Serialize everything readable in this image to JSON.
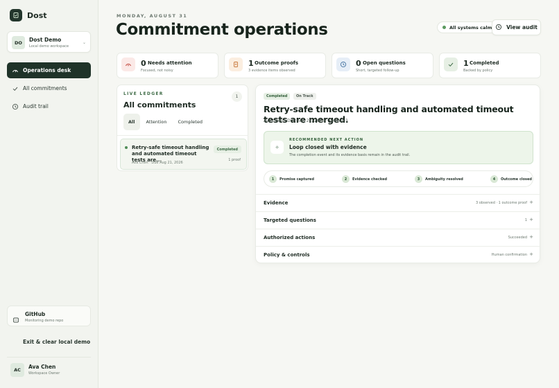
{
  "app": {
    "name": "Dost"
  },
  "workspace": {
    "initials": "DO",
    "name": "Dost Demo",
    "subtitle": "Local demo workspace"
  },
  "nav": [
    {
      "label": "Operations desk",
      "icon": "gauge-icon",
      "active": true
    },
    {
      "label": "All commitments",
      "icon": "check-icon",
      "active": false
    },
    {
      "label": "Audit trail",
      "icon": "history-icon",
      "active": false
    }
  ],
  "github": {
    "title": "GitHub",
    "subtitle": "Monitoring demo repo"
  },
  "exit_label": "Exit & clear local demo",
  "user": {
    "initials": "AC",
    "name": "Ava Chen",
    "role": "Workspace Owner"
  },
  "header": {
    "date": "MONDAY, AUGUST 31",
    "title": "Commitment operations",
    "status": "All systems calm",
    "view_audit": "View audit"
  },
  "stats": [
    {
      "num": "0",
      "label": "Needs attention",
      "sub": "Focused, not noisy",
      "icon": "alert-icon",
      "color": "#fbe9e7"
    },
    {
      "num": "1",
      "label": "Outcome proofs",
      "sub": "3 evidence items observed",
      "icon": "document-icon",
      "color": "#fbeee0"
    },
    {
      "num": "0",
      "label": "Open questions",
      "sub": "Short, targeted follow-up",
      "icon": "history-icon",
      "color": "#e6eef7"
    },
    {
      "num": "1",
      "label": "Completed",
      "sub": "Backed by policy",
      "icon": "check-icon",
      "color": "#e6efe4"
    }
  ],
  "ledger": {
    "kicker": "LIVE LEDGER",
    "title": "All commitments",
    "count": "1",
    "tabs": [
      "All",
      "Attention",
      "Completed"
    ],
    "item": {
      "title": "Retry-safe timeout handling and automated timeout tests are...",
      "meta": "Ava Chen · Due Aug 21, 2026",
      "badge": "Completed",
      "proof": "1 proof"
    }
  },
  "detail": {
    "badge_status": "Completed",
    "badge_track": "On Track",
    "title": "Retry-safe timeout handling and automated timeout tests are merged.",
    "meta": "Ava Chen · Due Aug 21, 2026 · Version 1",
    "recommended": {
      "kicker": "RECOMMENDED NEXT ACTION",
      "title": "Loop closed with evidence",
      "subtitle": "The completion event and its evidence basis remain in the audit trail."
    },
    "steps": [
      {
        "num": "1",
        "label": "Promise captured"
      },
      {
        "num": "2",
        "label": "Evidence checked"
      },
      {
        "num": "3",
        "label": "Ambiguity resolved"
      },
      {
        "num": "4",
        "label": "Outcome closed"
      }
    ],
    "sections": [
      {
        "label": "Evidence",
        "meta": "3 observed · 1 outcome proof"
      },
      {
        "label": "Targeted questions",
        "meta": "1"
      },
      {
        "label": "Authorized actions",
        "meta": "Succeeded"
      },
      {
        "label": "Policy & controls",
        "meta": "Human confirmation"
      }
    ]
  }
}
